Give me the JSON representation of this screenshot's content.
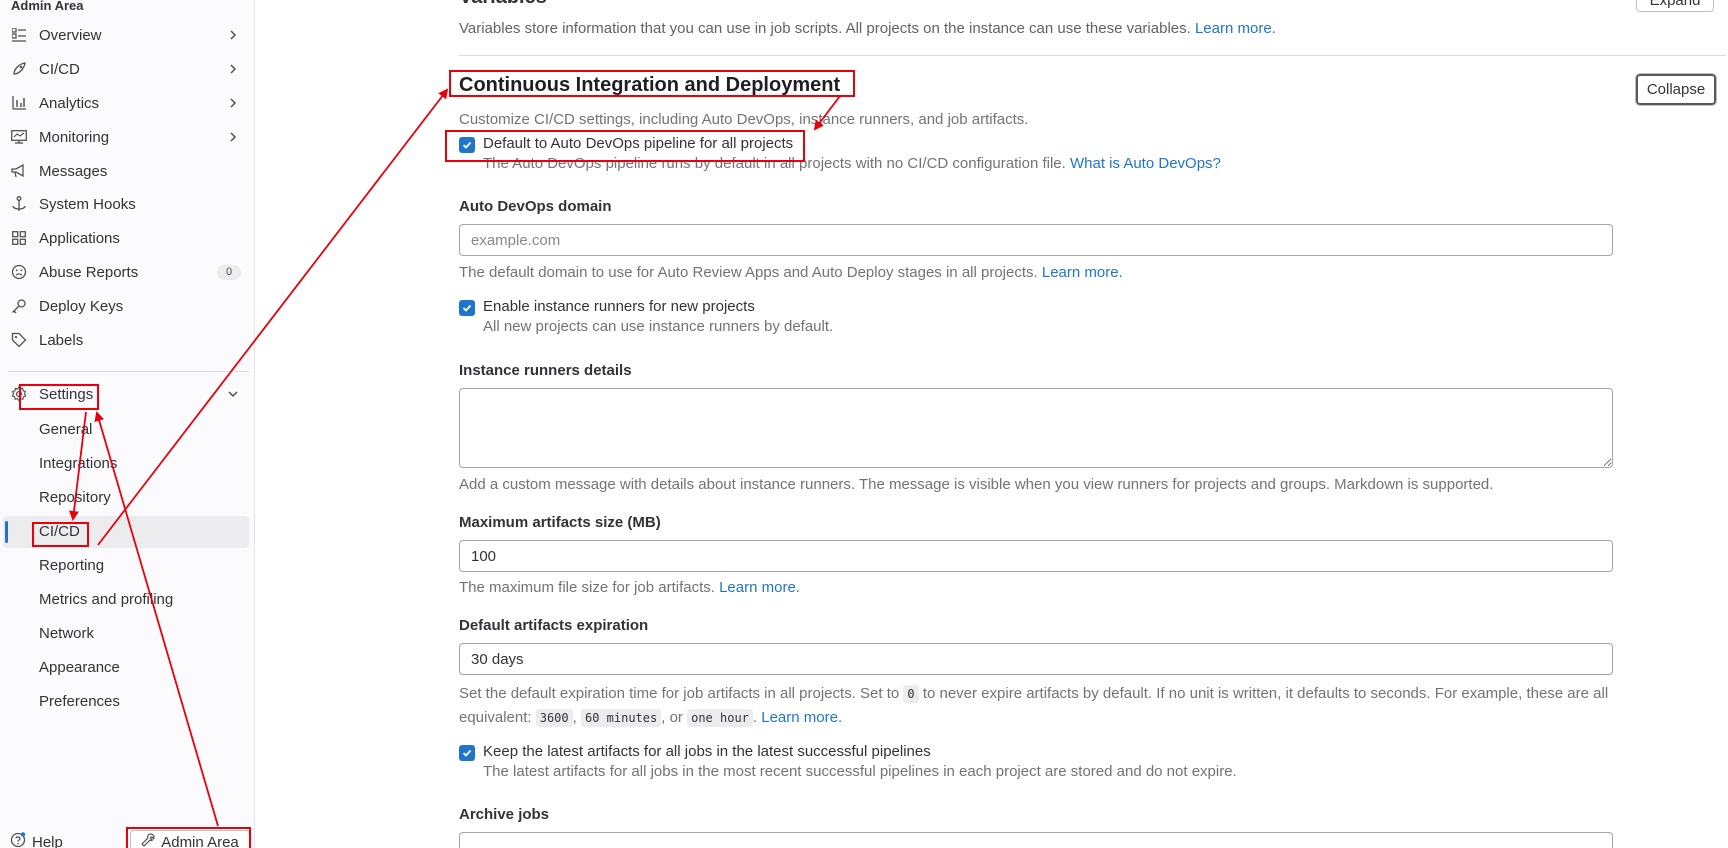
{
  "sidebar": {
    "header": "Admin Area",
    "items": [
      {
        "label": "Overview",
        "icon": "overview-icon",
        "chevron": true
      },
      {
        "label": "CI/CD",
        "icon": "rocket-icon",
        "chevron": true
      },
      {
        "label": "Analytics",
        "icon": "chart-icon",
        "chevron": true
      },
      {
        "label": "Monitoring",
        "icon": "monitor-icon",
        "chevron": true
      },
      {
        "label": "Messages",
        "icon": "bullhorn-icon"
      },
      {
        "label": "System Hooks",
        "icon": "anchor-icon"
      },
      {
        "label": "Applications",
        "icon": "applications-icon"
      },
      {
        "label": "Abuse Reports",
        "icon": "sad-face-icon",
        "badge": "0"
      },
      {
        "label": "Deploy Keys",
        "icon": "key-icon"
      },
      {
        "label": "Labels",
        "icon": "label-icon"
      },
      {
        "label": "Settings",
        "icon": "gear-icon",
        "expanded": true
      }
    ],
    "settings_subitems": [
      "General",
      "Integrations",
      "Repository",
      "CI/CD",
      "Reporting",
      "Metrics and profiling",
      "Network",
      "Appearance",
      "Preferences"
    ],
    "active_subitem": "CI/CD",
    "footer": {
      "help": "Help",
      "admin": "Admin Area"
    }
  },
  "variables_section": {
    "title": "Variables",
    "description": "Variables store information that you can use in job scripts. All projects on the instance can use these variables.",
    "learn_more": "Learn more.",
    "expand_label": "Expand"
  },
  "cicd_section": {
    "title": "Continuous Integration and Deployment",
    "description": "Customize CI/CD settings, including Auto DevOps, instance runners, and job artifacts.",
    "collapse_label": "Collapse",
    "auto_devops_checkbox": "Default to Auto DevOps pipeline for all projects",
    "auto_devops_help": "The Auto DevOps pipeline runs by default in all projects with no CI/CD configuration file.",
    "auto_devops_link": "What is Auto DevOps?",
    "domain_label": "Auto DevOps domain",
    "domain_placeholder": "example.com",
    "domain_help": "The default domain to use for Auto Review Apps and Auto Deploy stages in all projects.",
    "domain_link": "Learn more.",
    "runners_checkbox": "Enable instance runners for new projects",
    "runners_help": "All new projects can use instance runners by default.",
    "runner_details_label": "Instance runners details",
    "runner_details_help": "Add a custom message with details about instance runners. The message is visible when you view runners for projects and groups. Markdown is supported.",
    "max_artifacts_label": "Maximum artifacts size (MB)",
    "max_artifacts_value": "100",
    "max_artifacts_help": "The maximum file size for job artifacts.",
    "max_artifacts_link": "Learn more.",
    "expiration_label": "Default artifacts expiration",
    "expiration_value": "30 days",
    "expiration_help_1": "Set the default expiration time for job artifacts in all projects. Set to",
    "expiration_code_0": "0",
    "expiration_help_2": "to never expire artifacts by default. If no unit is written, it defaults to seconds. For example, these are",
    "expiration_help_3": "all equivalent:",
    "expiration_code_1": "3600",
    "expiration_code_2": "60 minutes",
    "expiration_or": ", or",
    "expiration_code_3": "one hour",
    "expiration_link": "Learn more.",
    "keep_latest_checkbox": "Keep the latest artifacts for all jobs in the latest successful pipelines",
    "keep_latest_help": "The latest artifacts for all jobs in the most recent successful pipelines in each project are stored and do not expire.",
    "archive_jobs_label": "Archive jobs"
  },
  "colors": {
    "accent": "#1f75cb",
    "annotation": "#e8000b"
  }
}
